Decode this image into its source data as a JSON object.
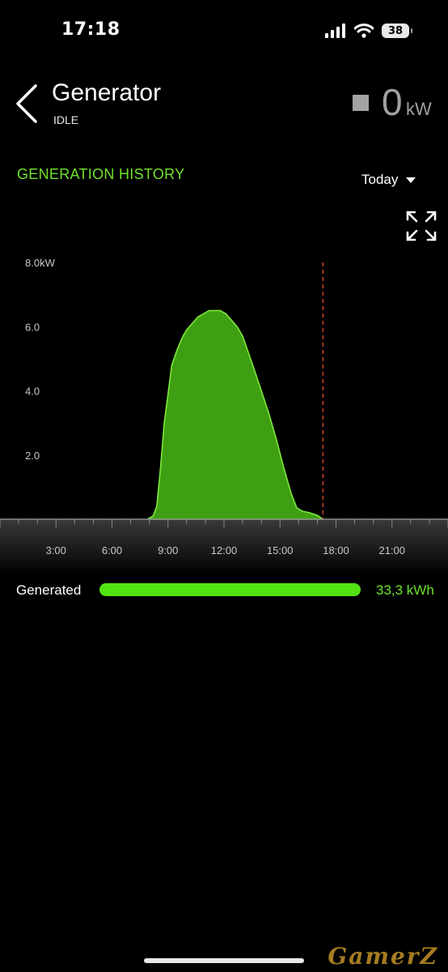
{
  "status_bar": {
    "time": "17:18",
    "battery": "38"
  },
  "header": {
    "title": "Generator",
    "status": "IDLE",
    "power_value": "0",
    "power_unit": "kW"
  },
  "section": {
    "title": "GENERATION HISTORY",
    "period": "Today"
  },
  "chart_data": {
    "type": "area",
    "title": "",
    "xlabel": "",
    "ylabel": "",
    "y_tick_labels": [
      "8.0kW",
      "6.0",
      "4.0",
      "2.0"
    ],
    "x_tick_labels": [
      "3:00",
      "6:00",
      "9:00",
      "12:00",
      "15:00",
      "18:00",
      "21:00"
    ],
    "xlim": [
      0,
      24
    ],
    "ylim": [
      0,
      8
    ],
    "current_time": 17.3,
    "series": [
      {
        "x": [
          7.9,
          8.2,
          8.4,
          8.6,
          8.8,
          9.0,
          9.2,
          9.5,
          9.8,
          10.0,
          10.3,
          10.6,
          10.9,
          11.2,
          11.5,
          11.8,
          12.1,
          12.4,
          12.7,
          13.0,
          13.3,
          13.6,
          14.0,
          14.4,
          14.8,
          15.2,
          15.6,
          15.9,
          16.2,
          16.6,
          17.0,
          17.3
        ],
        "y": [
          0,
          0.1,
          0.4,
          1.6,
          3.0,
          3.9,
          4.8,
          5.3,
          5.7,
          5.9,
          6.1,
          6.3,
          6.4,
          6.5,
          6.5,
          6.5,
          6.4,
          6.2,
          6.0,
          5.7,
          5.2,
          4.7,
          4.0,
          3.3,
          2.5,
          1.6,
          0.8,
          0.35,
          0.25,
          0.2,
          0.12,
          0
        ]
      }
    ],
    "colors": {
      "fill": "#3f9f12",
      "stroke": "#7de83c",
      "current_line": "#e0482c"
    }
  },
  "summary": {
    "label": "Generated",
    "value": "33,3 kWh",
    "fill_fraction": 1.0
  },
  "watermark": "GamerZ"
}
